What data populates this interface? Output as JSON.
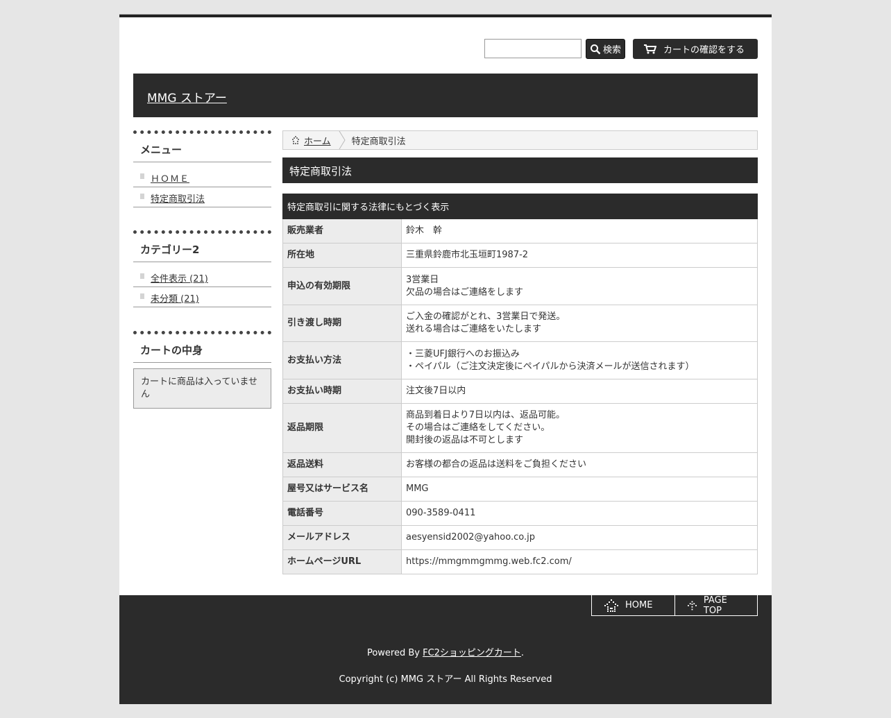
{
  "top": {
    "search_button": "検索",
    "cart_button": "カートの確認をする"
  },
  "header": {
    "site_title": "MMG ストアー"
  },
  "sidebar": {
    "menu_title": "メニュー",
    "menu_items": [
      "ＨＯＭＥ",
      "特定商取引法"
    ],
    "category_title": "カテゴリー2",
    "category_items": [
      "全件表示 (21)",
      "未分類 (21)"
    ],
    "cart_title": "カートの中身",
    "cart_empty": "カートに商品は入っていません"
  },
  "breadcrumb": {
    "home": "ホーム",
    "current": "特定商取引法"
  },
  "main": {
    "page_title": "特定商取引法",
    "table_caption": "特定商取引に関する法律にもとづく表示",
    "rows": [
      {
        "label": "販売業者",
        "value": "鈴木　幹"
      },
      {
        "label": "所在地",
        "value": "三重県鈴鹿市北玉垣町1987-2"
      },
      {
        "label": "申込の有効期限",
        "value": "3営業日\n欠品の場合はご連絡をします"
      },
      {
        "label": "引き渡し時期",
        "value": "ご入金の確認がとれ、3営業日で発送。\n送れる場合はご連絡をいたします"
      },
      {
        "label": "お支払い方法",
        "value": "・三菱UFJ銀行へのお振込み\n・ペイパル（ご注文決定後にペイパルから決済メールが送信されます）"
      },
      {
        "label": "お支払い時期",
        "value": "注文後7日以内"
      },
      {
        "label": "返品期限",
        "value": "商品到着日より7日以内は、返品可能。\nその場合はご連絡をしてください。\n開封後の返品は不可とします"
      },
      {
        "label": "返品送料",
        "value": "お客様の都合の返品は送料をご負担ください"
      },
      {
        "label": "屋号又はサービス名",
        "value": "MMG"
      },
      {
        "label": "電話番号",
        "value": "090-3589-0411"
      },
      {
        "label": "メールアドレス",
        "value": "aesyensid2002@yahoo.co.jp"
      },
      {
        "label": "ホームページURL",
        "value": "https://mmgmmgmmg.web.fc2.com/"
      }
    ]
  },
  "footer": {
    "home": "HOME",
    "page_top": "PAGE TOP",
    "powered_prefix": "Powered By ",
    "powered_link": "FC2ショッピングカート",
    "powered_suffix": ".",
    "copyright": "Copyright (c) MMG ストアー All Rights Reserved"
  }
}
